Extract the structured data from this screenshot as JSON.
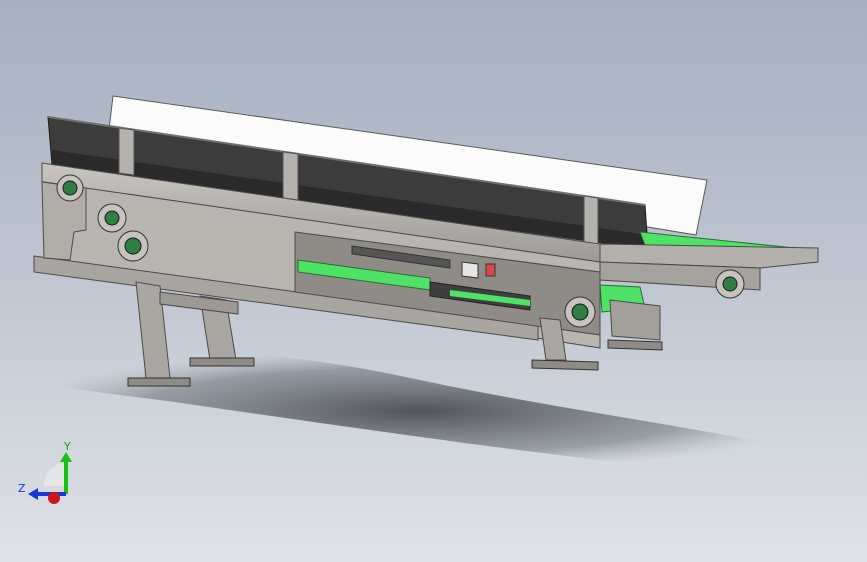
{
  "viewport": {
    "view_name": "3d-model-viewport",
    "background_top": "#a6b0c1",
    "background_bottom": "#dfe2e7"
  },
  "model": {
    "name": "belt-conveyor-assembly",
    "frame_color": "#b9b6b2",
    "belt_color": "#4ee266",
    "guard_color": "#3a3a3a",
    "cover_color": "#ffffff"
  },
  "triad": {
    "x_label": "",
    "y_label": "Y",
    "z_label": "Z",
    "x_color": "#d01818",
    "y_color": "#18c018",
    "z_color": "#1838d8"
  }
}
